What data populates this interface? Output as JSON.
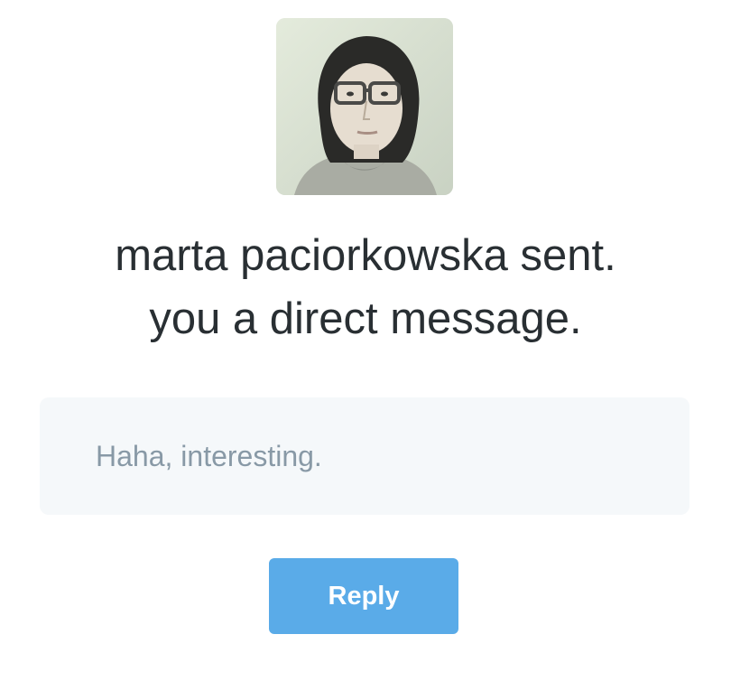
{
  "notification": {
    "sender_name": "marta paciorkowska",
    "headline_line1": "marta paciorkowska sent.",
    "headline_line2": "you a direct message."
  },
  "message": {
    "text": "Haha, interesting."
  },
  "actions": {
    "reply_label": "Reply"
  },
  "colors": {
    "headline": "#292f33",
    "message_text": "#8899a6",
    "message_bg": "#f5f8fa",
    "reply_bg": "#5aabe8",
    "reply_text": "#ffffff"
  },
  "avatar": {
    "icon": "user-avatar-photo"
  }
}
